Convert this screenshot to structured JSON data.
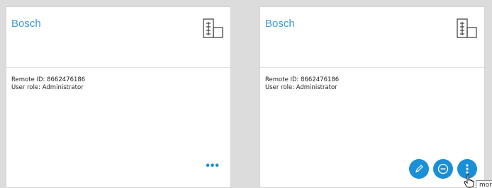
{
  "cards": [
    {
      "title": "Bosch",
      "remote_id": "Remote ID: 8662476186",
      "user_role": "User role: Administrator",
      "icon": "building-icon",
      "more_label": "•••"
    },
    {
      "title": "Bosch",
      "remote_id": "Remote ID: 8662476186",
      "user_role": "User role: Administrator",
      "icon": "building-icon",
      "actions": [
        {
          "icon": "pencil-icon"
        },
        {
          "icon": "minus-circle-icon"
        },
        {
          "icon": "vertical-dots-icon"
        }
      ],
      "tooltip": "more"
    }
  ],
  "colors": {
    "accent": "#1a8fd6",
    "title": "#3d9ad6",
    "background": "#dcdcdc"
  }
}
